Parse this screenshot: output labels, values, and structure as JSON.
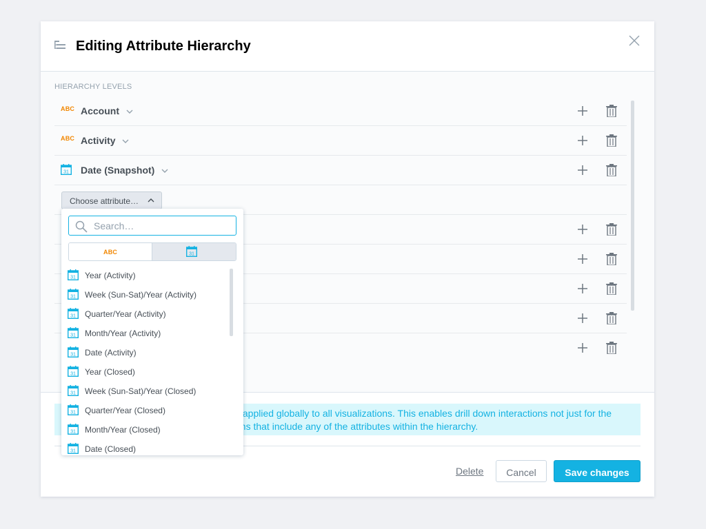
{
  "dialog": {
    "title": "Editing Attribute Hierarchy",
    "close_icon": "close-icon",
    "hierarchy_icon": "hierarchy-icon"
  },
  "levels": {
    "section_label": "HIERARCHY LEVELS",
    "items": [
      {
        "type": "text",
        "type_label": "ABC",
        "name": "Account"
      },
      {
        "type": "text",
        "type_label": "ABC",
        "name": "Activity"
      },
      {
        "type": "date",
        "name": "Date (Snapshot)"
      }
    ],
    "choose_button": "Choose attribute…",
    "extra_rows": 5
  },
  "dropdown": {
    "search_placeholder": "Search…",
    "search_value": "",
    "toggle": {
      "text_label": "ABC",
      "selected": "date"
    },
    "items": [
      "Year (Activity)",
      "Week (Sun-Sat)/Year (Activity)",
      "Quarter/Year (Activity)",
      "Month/Year (Activity)",
      "Date (Activity)",
      "Year (Closed)",
      "Week (Sun-Sat)/Year (Closed)",
      "Quarter/Year (Closed)",
      "Month/Year (Closed)",
      "Date (Closed)"
    ]
  },
  "info": {
    "line1": "s applied globally to all visualizations. This enables drill down interactions not just for the",
    "line2": "ons that include any of the attributes within the hierarchy."
  },
  "footer": {
    "delete_label": "Delete",
    "cancel_label": "Cancel",
    "save_label": "Save changes"
  },
  "colors": {
    "accent": "#14b2e2",
    "text_type": "#f18600",
    "info_bg": "#d9f7fc"
  }
}
